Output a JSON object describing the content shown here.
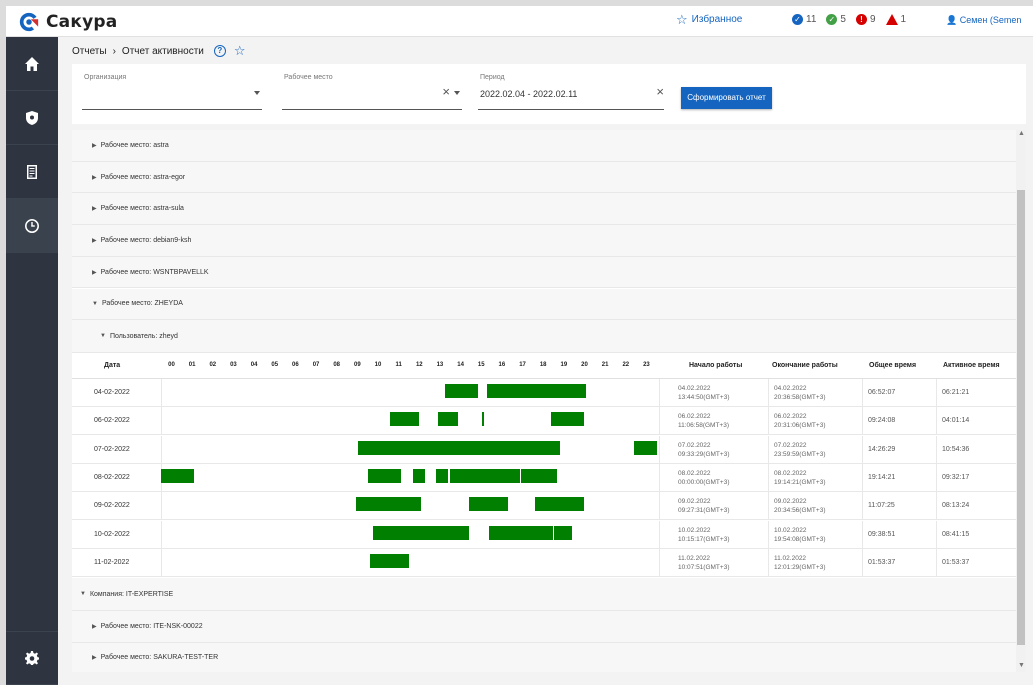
{
  "app": {
    "name": "Сакура"
  },
  "topbar": {
    "favorites_label": "Избранное",
    "counters": [
      {
        "color": "#1565c0",
        "value": "11",
        "icon": "check-circle-icon"
      },
      {
        "color": "#43a047",
        "value": "5",
        "icon": "check-circle-icon"
      },
      {
        "color": "#d50000",
        "value": "9",
        "icon": "alert-circle-icon"
      },
      {
        "color": "#d50000",
        "value": "1",
        "icon": "warning-triangle-icon"
      }
    ],
    "user_label": "Семен (Semen"
  },
  "breadcrumb": {
    "root": "Отчеты",
    "separator": "›",
    "current": "Отчет активности"
  },
  "filters": {
    "organization_label": "Организация",
    "organization_value": "",
    "workstation_label": "Рабочее место",
    "workstation_value": "",
    "period_label": "Период",
    "period_value": "2022.02.04 - 2022.02.11",
    "submit_label": "Сформировать отчет"
  },
  "groups": [
    {
      "label": "Рабочее место: astra",
      "expanded": false
    },
    {
      "label": "Рабочее место: astra-egor",
      "expanded": false
    },
    {
      "label": "Рабочее место: astra-sula",
      "expanded": false
    },
    {
      "label": "Рабочее место: debian9-ksh",
      "expanded": false
    },
    {
      "label": "Рабочее место: WSNTBPAVELLK",
      "expanded": false
    },
    {
      "label": "Рабочее место: ZHEYDA",
      "expanded": true
    }
  ],
  "user_group": {
    "label": "Пользователь: zheyd",
    "expanded": true
  },
  "table": {
    "headers": {
      "date": "Дата",
      "start": "Начало работы",
      "end": "Окончание работы",
      "total": "Общее время",
      "active": "Активное время"
    },
    "hours": [
      "00",
      "01",
      "02",
      "03",
      "04",
      "05",
      "06",
      "07",
      "08",
      "09",
      "10",
      "11",
      "12",
      "13",
      "14",
      "15",
      "16",
      "17",
      "18",
      "19",
      "20",
      "21",
      "22",
      "23"
    ],
    "rows": [
      {
        "date": "04-02-2022",
        "start_date": "04.02.2022",
        "start_time": "13:44:50(GMT+3)",
        "end_date": "04.02.2022",
        "end_time": "20:36:58(GMT+3)",
        "total": "06:52:07",
        "active": "06:21:21",
        "segments": [
          [
            13.75,
            15.35
          ],
          [
            15.8,
            20.6
          ]
        ]
      },
      {
        "date": "06-02-2022",
        "start_date": "06.02.2022",
        "start_time": "11:06:58(GMT+3)",
        "end_date": "06.02.2022",
        "end_time": "20:31:06(GMT+3)",
        "total": "09:24:08",
        "active": "04:01:14",
        "segments": [
          [
            11.1,
            12.5
          ],
          [
            13.4,
            14.4
          ],
          [
            15.55,
            15.62
          ],
          [
            18.9,
            20.5
          ]
        ]
      },
      {
        "date": "07-02-2022",
        "start_date": "07.02.2022",
        "start_time": "09:33:29(GMT+3)",
        "end_date": "07.02.2022",
        "end_time": "23:59:59(GMT+3)",
        "total": "14:26:29",
        "active": "10:54:36",
        "segments": [
          [
            9.55,
            19.3
          ],
          [
            22.9,
            24.0
          ]
        ]
      },
      {
        "date": "08-02-2022",
        "start_date": "08.02.2022",
        "start_time": "00:00:00(GMT+3)",
        "end_date": "08.02.2022",
        "end_time": "19:14:21(GMT+3)",
        "total": "19:14:21",
        "active": "09:32:17",
        "segments": [
          [
            0.0,
            1.6
          ],
          [
            10.0,
            11.6
          ],
          [
            12.2,
            12.8
          ],
          [
            13.3,
            13.9
          ],
          [
            14.0,
            17.4
          ],
          [
            17.45,
            19.2
          ]
        ]
      },
      {
        "date": "09-02-2022",
        "start_date": "09.02.2022",
        "start_time": "09:27:31(GMT+3)",
        "end_date": "09.02.2022",
        "end_time": "20:34:56(GMT+3)",
        "total": "11:07:25",
        "active": "08:13:24",
        "segments": [
          [
            9.45,
            12.6
          ],
          [
            14.9,
            16.8
          ],
          [
            18.1,
            20.5
          ]
        ]
      },
      {
        "date": "10-02-2022",
        "start_date": "10.02.2022",
        "start_time": "10:15:17(GMT+3)",
        "end_date": "10.02.2022",
        "end_time": "19:54:08(GMT+3)",
        "total": "09:38:51",
        "active": "08:41:15",
        "segments": [
          [
            10.25,
            14.9
          ],
          [
            15.9,
            19.0
          ],
          [
            19.05,
            19.9
          ]
        ]
      },
      {
        "date": "11-02-2022",
        "start_date": "11.02.2022",
        "start_time": "10:07:51(GMT+3)",
        "end_date": "11.02.2022",
        "end_time": "12:01:29(GMT+3)",
        "total": "01:53:37",
        "active": "01:53:37",
        "segments": [
          [
            10.13,
            12.02
          ]
        ]
      }
    ]
  },
  "company_group": {
    "label": "Компания: IT-EXPERTISE",
    "expanded": true
  },
  "bottom_groups": [
    {
      "label": "Рабочее место: ITE-NSK-00022",
      "expanded": false
    },
    {
      "label": "Рабочее место: SAKURA-TEST-TER",
      "expanded": false
    }
  ],
  "colors": {
    "activity": "#007f00",
    "accent": "#1565c0",
    "sidebar": "#2e3540"
  }
}
